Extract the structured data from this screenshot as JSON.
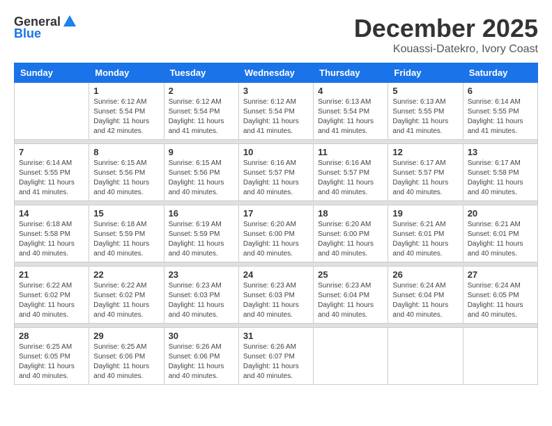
{
  "header": {
    "logo_general": "General",
    "logo_blue": "Blue",
    "month_year": "December 2025",
    "location": "Kouassi-Datekro, Ivory Coast"
  },
  "weekdays": [
    "Sunday",
    "Monday",
    "Tuesday",
    "Wednesday",
    "Thursday",
    "Friday",
    "Saturday"
  ],
  "weeks": [
    [
      {
        "day": "",
        "info": ""
      },
      {
        "day": "1",
        "info": "Sunrise: 6:12 AM\nSunset: 5:54 PM\nDaylight: 11 hours\nand 42 minutes."
      },
      {
        "day": "2",
        "info": "Sunrise: 6:12 AM\nSunset: 5:54 PM\nDaylight: 11 hours\nand 41 minutes."
      },
      {
        "day": "3",
        "info": "Sunrise: 6:12 AM\nSunset: 5:54 PM\nDaylight: 11 hours\nand 41 minutes."
      },
      {
        "day": "4",
        "info": "Sunrise: 6:13 AM\nSunset: 5:54 PM\nDaylight: 11 hours\nand 41 minutes."
      },
      {
        "day": "5",
        "info": "Sunrise: 6:13 AM\nSunset: 5:55 PM\nDaylight: 11 hours\nand 41 minutes."
      },
      {
        "day": "6",
        "info": "Sunrise: 6:14 AM\nSunset: 5:55 PM\nDaylight: 11 hours\nand 41 minutes."
      }
    ],
    [
      {
        "day": "7",
        "info": "Sunrise: 6:14 AM\nSunset: 5:55 PM\nDaylight: 11 hours\nand 41 minutes."
      },
      {
        "day": "8",
        "info": "Sunrise: 6:15 AM\nSunset: 5:56 PM\nDaylight: 11 hours\nand 40 minutes."
      },
      {
        "day": "9",
        "info": "Sunrise: 6:15 AM\nSunset: 5:56 PM\nDaylight: 11 hours\nand 40 minutes."
      },
      {
        "day": "10",
        "info": "Sunrise: 6:16 AM\nSunset: 5:57 PM\nDaylight: 11 hours\nand 40 minutes."
      },
      {
        "day": "11",
        "info": "Sunrise: 6:16 AM\nSunset: 5:57 PM\nDaylight: 11 hours\nand 40 minutes."
      },
      {
        "day": "12",
        "info": "Sunrise: 6:17 AM\nSunset: 5:57 PM\nDaylight: 11 hours\nand 40 minutes."
      },
      {
        "day": "13",
        "info": "Sunrise: 6:17 AM\nSunset: 5:58 PM\nDaylight: 11 hours\nand 40 minutes."
      }
    ],
    [
      {
        "day": "14",
        "info": "Sunrise: 6:18 AM\nSunset: 5:58 PM\nDaylight: 11 hours\nand 40 minutes."
      },
      {
        "day": "15",
        "info": "Sunrise: 6:18 AM\nSunset: 5:59 PM\nDaylight: 11 hours\nand 40 minutes."
      },
      {
        "day": "16",
        "info": "Sunrise: 6:19 AM\nSunset: 5:59 PM\nDaylight: 11 hours\nand 40 minutes."
      },
      {
        "day": "17",
        "info": "Sunrise: 6:20 AM\nSunset: 6:00 PM\nDaylight: 11 hours\nand 40 minutes."
      },
      {
        "day": "18",
        "info": "Sunrise: 6:20 AM\nSunset: 6:00 PM\nDaylight: 11 hours\nand 40 minutes."
      },
      {
        "day": "19",
        "info": "Sunrise: 6:21 AM\nSunset: 6:01 PM\nDaylight: 11 hours\nand 40 minutes."
      },
      {
        "day": "20",
        "info": "Sunrise: 6:21 AM\nSunset: 6:01 PM\nDaylight: 11 hours\nand 40 minutes."
      }
    ],
    [
      {
        "day": "21",
        "info": "Sunrise: 6:22 AM\nSunset: 6:02 PM\nDaylight: 11 hours\nand 40 minutes."
      },
      {
        "day": "22",
        "info": "Sunrise: 6:22 AM\nSunset: 6:02 PM\nDaylight: 11 hours\nand 40 minutes."
      },
      {
        "day": "23",
        "info": "Sunrise: 6:23 AM\nSunset: 6:03 PM\nDaylight: 11 hours\nand 40 minutes."
      },
      {
        "day": "24",
        "info": "Sunrise: 6:23 AM\nSunset: 6:03 PM\nDaylight: 11 hours\nand 40 minutes."
      },
      {
        "day": "25",
        "info": "Sunrise: 6:23 AM\nSunset: 6:04 PM\nDaylight: 11 hours\nand 40 minutes."
      },
      {
        "day": "26",
        "info": "Sunrise: 6:24 AM\nSunset: 6:04 PM\nDaylight: 11 hours\nand 40 minutes."
      },
      {
        "day": "27",
        "info": "Sunrise: 6:24 AM\nSunset: 6:05 PM\nDaylight: 11 hours\nand 40 minutes."
      }
    ],
    [
      {
        "day": "28",
        "info": "Sunrise: 6:25 AM\nSunset: 6:05 PM\nDaylight: 11 hours\nand 40 minutes."
      },
      {
        "day": "29",
        "info": "Sunrise: 6:25 AM\nSunset: 6:06 PM\nDaylight: 11 hours\nand 40 minutes."
      },
      {
        "day": "30",
        "info": "Sunrise: 6:26 AM\nSunset: 6:06 PM\nDaylight: 11 hours\nand 40 minutes."
      },
      {
        "day": "31",
        "info": "Sunrise: 6:26 AM\nSunset: 6:07 PM\nDaylight: 11 hours\nand 40 minutes."
      },
      {
        "day": "",
        "info": ""
      },
      {
        "day": "",
        "info": ""
      },
      {
        "day": "",
        "info": ""
      }
    ]
  ]
}
